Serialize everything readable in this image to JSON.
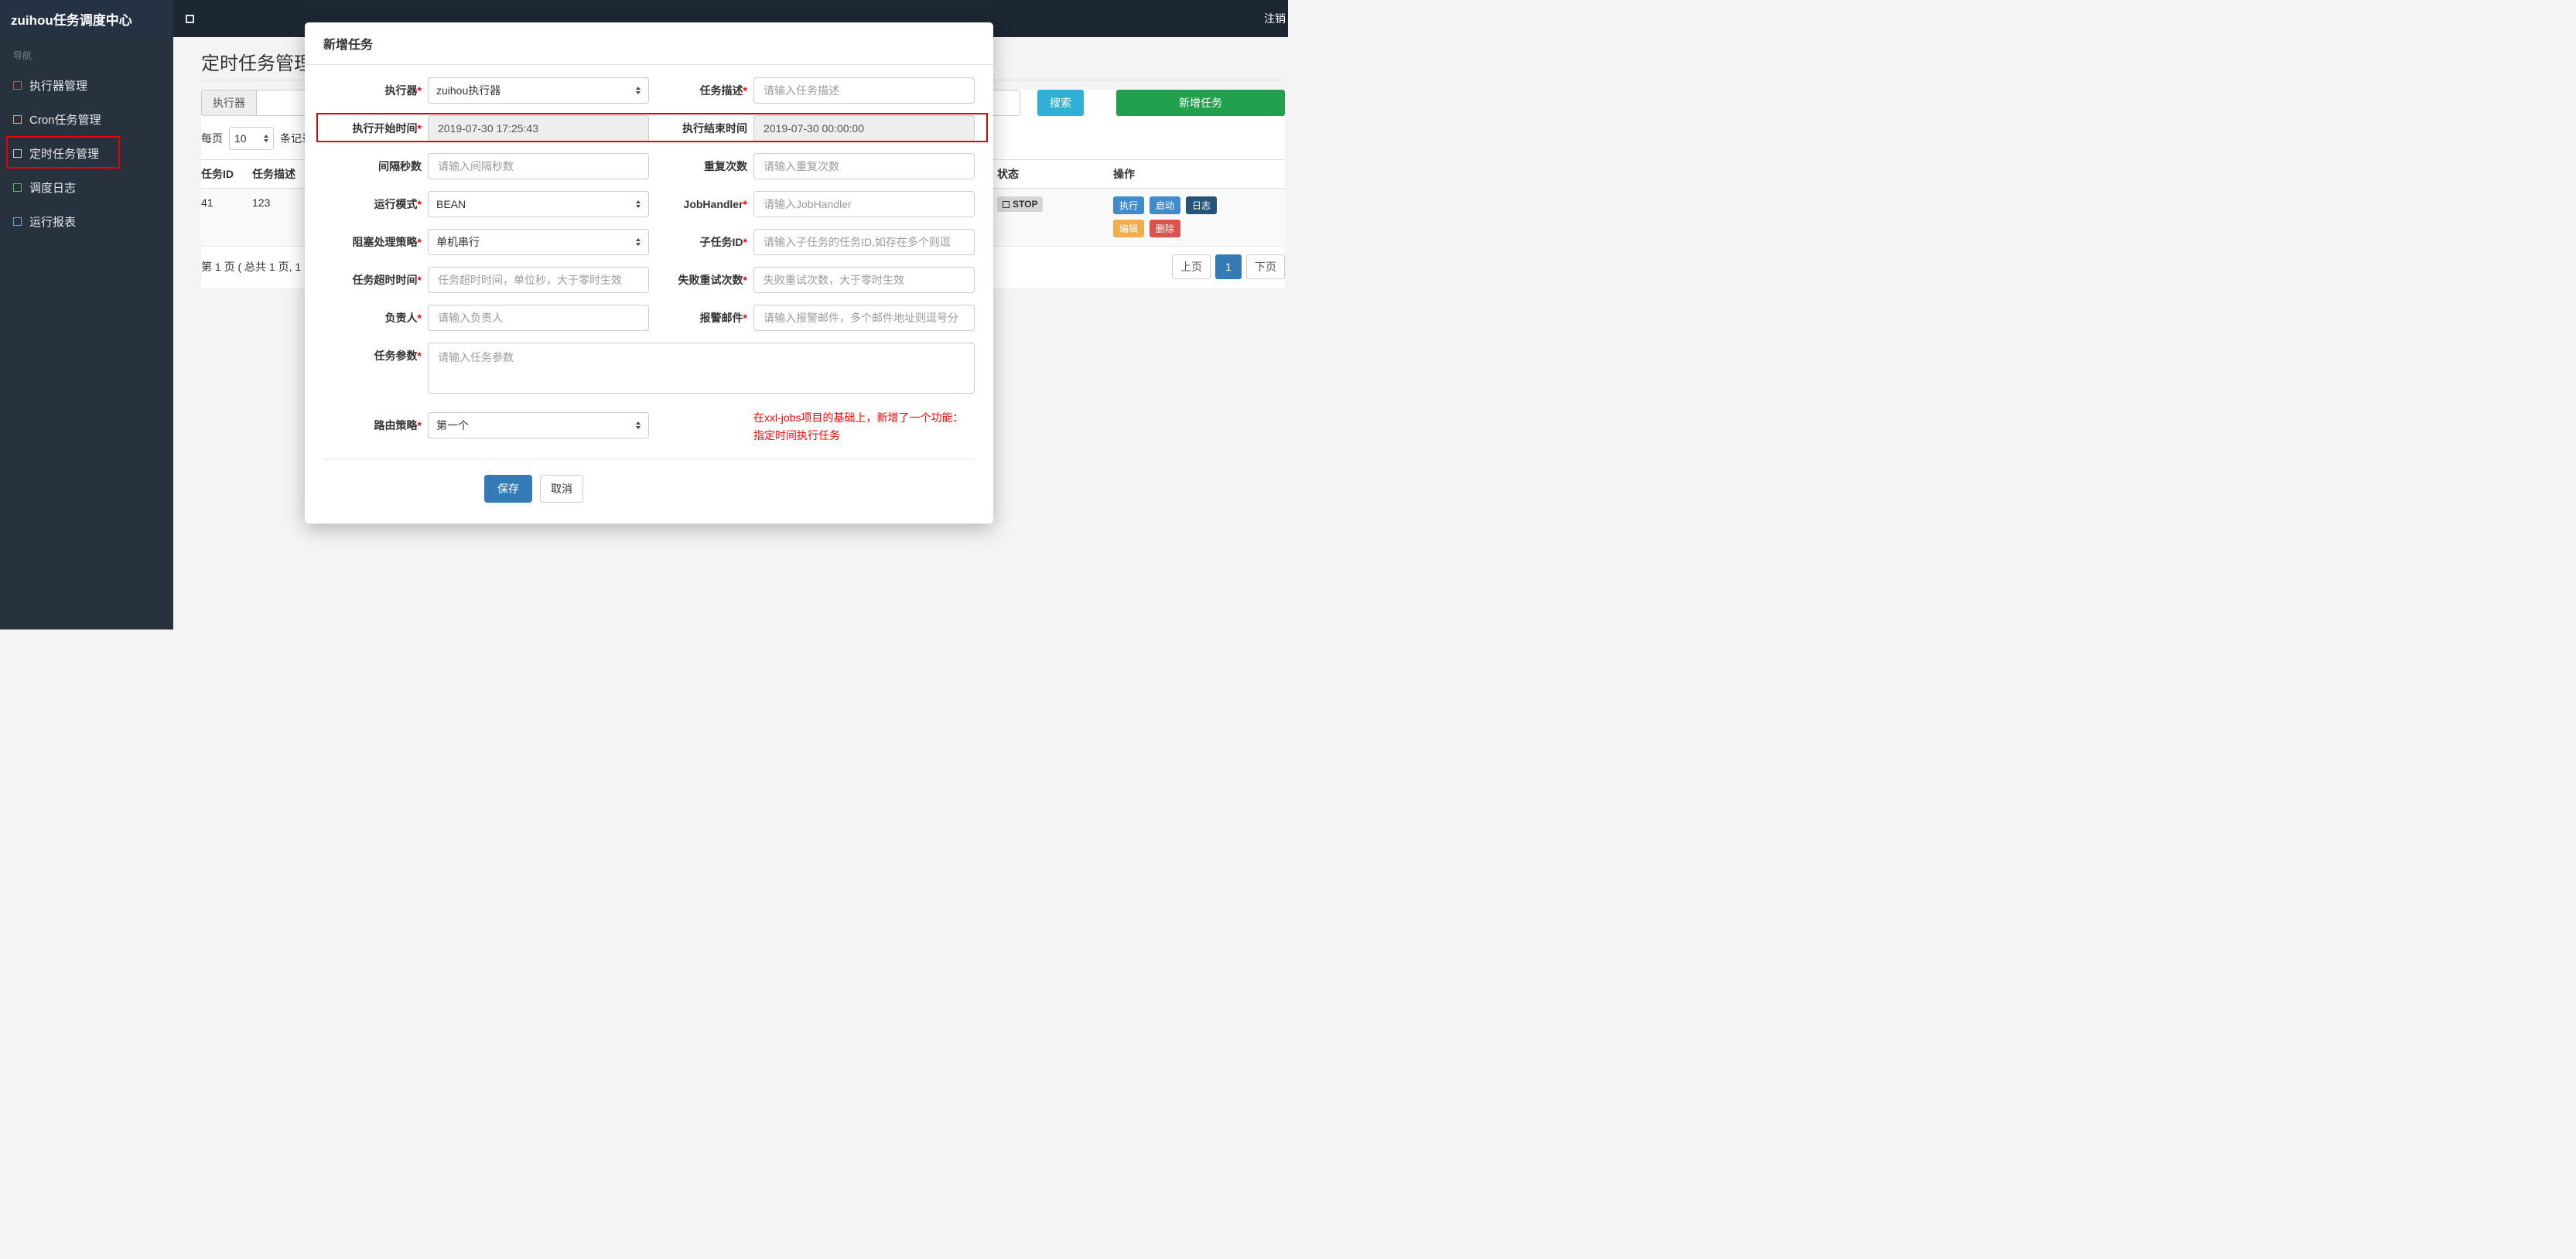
{
  "topbar": {
    "brand": "zuihou任务调度中心",
    "logout": "注销"
  },
  "sidebar": {
    "nav_header": "导航",
    "items": [
      {
        "label": "执行器管理",
        "icon_color": "#d9534f"
      },
      {
        "label": "Cron任务管理",
        "icon_color": "#f0ad4e"
      },
      {
        "label": "定时任务管理",
        "icon_color": "#c8d0d6"
      },
      {
        "label": "调度日志",
        "icon_color": "#5cb85c"
      },
      {
        "label": "运行报表",
        "icon_color": "#56b4d3"
      }
    ]
  },
  "main": {
    "page_title": "定时任务管理",
    "filter": {
      "executor_label": "执行器",
      "search_button": "搜索",
      "add_button": "新增任务"
    },
    "perpage": {
      "label_before": "每页",
      "value": "10",
      "label_after": "条记录"
    },
    "table": {
      "headers": [
        "任务ID",
        "任务描述",
        "状态",
        "操作"
      ],
      "row": {
        "id": "41",
        "desc": "123",
        "status": "STOP",
        "actions": [
          "执行",
          "启动",
          "日志",
          "编辑",
          "删除"
        ]
      }
    },
    "pagination": {
      "summary": "第 1 页 ( 总共 1 页, 1",
      "prev": "上页",
      "page": "1",
      "next": "下页"
    }
  },
  "modal": {
    "title": "新增任务",
    "required_marker": "*",
    "fields": {
      "executor": {
        "label": "执行器",
        "value": "zuihou执行器"
      },
      "job_desc": {
        "label": "任务描述",
        "placeholder": "请输入任务描述"
      },
      "start_time": {
        "label": "执行开始时间",
        "value": "2019-07-30 17:25:43"
      },
      "end_time": {
        "label": "执行结束时间",
        "value": "2019-07-30 00:00:00"
      },
      "interval": {
        "label": "间隔秒数",
        "placeholder": "请输入间隔秒数"
      },
      "repeat": {
        "label": "重复次数",
        "placeholder": "请输入重复次数"
      },
      "run_mode": {
        "label": "运行模式",
        "value": "BEAN"
      },
      "job_handler": {
        "label": "JobHandler",
        "placeholder": "请输入JobHandler"
      },
      "block_strategy": {
        "label": "阻塞处理策略",
        "value": "单机串行"
      },
      "child_job_id": {
        "label": "子任务ID",
        "placeholder": "请输入子任务的任务ID,如存在多个则逗"
      },
      "timeout": {
        "label": "任务超时时间",
        "placeholder": "任务超时时间，单位秒，大于零时生效"
      },
      "fail_retry": {
        "label": "失败重试次数",
        "placeholder": "失败重试次数，大于零时生效"
      },
      "owner": {
        "label": "负责人",
        "placeholder": "请输入负责人"
      },
      "alarm_email": {
        "label": "报警邮件",
        "placeholder": "请输入报警邮件，多个邮件地址则逗号分"
      },
      "job_param": {
        "label": "任务参数",
        "placeholder": "请输入任务参数"
      },
      "route_strategy": {
        "label": "路由策略",
        "value": "第一个"
      }
    },
    "note": {
      "line1": "在xxl-jobs项目的基础上，新增了一个功能：",
      "line2": "指定时间执行任务"
    },
    "save_button": "保存",
    "cancel_button": "取消"
  },
  "colors": {
    "search_button": "#31b0d5",
    "add_button": "#23a04d",
    "exec_button": "#418bca",
    "start_button": "#418bca",
    "log_button": "#24547a",
    "edit_button": "#f0ad4e",
    "delete_button": "#d9534f",
    "save_button": "#337ab7",
    "active_page": "#337ab7",
    "annotation": "#e60000"
  }
}
